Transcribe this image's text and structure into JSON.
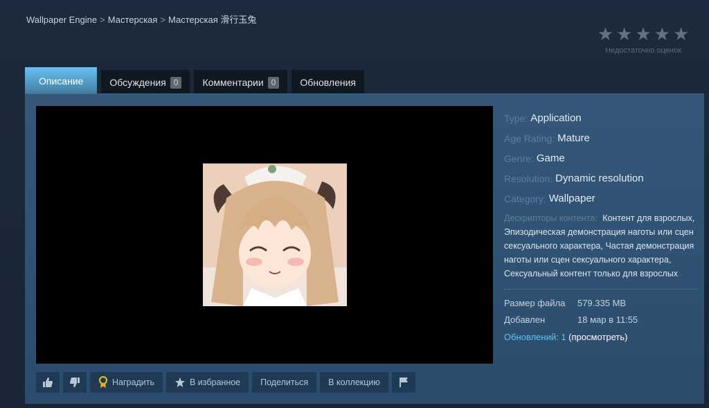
{
  "breadcrumb": {
    "items": [
      "Wallpaper Engine",
      "Мастерская",
      "Мастерская 滑行玉兔"
    ],
    "separator": ">"
  },
  "rating": {
    "stars": [
      "★",
      "★",
      "★",
      "★",
      "★"
    ],
    "text": "Недостаточно оценок"
  },
  "tabs": [
    {
      "label": "Описание",
      "active": true
    },
    {
      "label": "Обсуждения",
      "count": "0"
    },
    {
      "label": "Комментарии",
      "count": "0"
    },
    {
      "label": "Обновления"
    }
  ],
  "meta": {
    "type": {
      "label": "Type:",
      "value": "Application"
    },
    "age": {
      "label": "Age Rating:",
      "value": "Mature"
    },
    "genre": {
      "label": "Genre:",
      "value": "Game"
    },
    "resolution": {
      "label": "Resolution:",
      "value": "Dynamic resolution"
    },
    "category": {
      "label": "Category:",
      "value": "Wallpaper"
    },
    "descriptors": {
      "label": "Дескрипторы контента:",
      "value": "Контент для взрослых, Эпизодическая демонстрация наготы или сцен сексуального характера, Частая демонстрация наготы или сцен сексуального характера, Сексуальный контент только для взрослых"
    }
  },
  "stats": {
    "size": {
      "label": "Размер файла",
      "value": "579.335 MB"
    },
    "added": {
      "label": "Добавлен",
      "value": "18 мар в 11:55"
    }
  },
  "updates": {
    "label": "Обновлений: 1",
    "view": "(просмотреть)"
  },
  "actions": {
    "award": "Наградить",
    "favorite": "В избранное",
    "share": "Поделиться",
    "collection": "В коллекцию"
  },
  "colors": {
    "background": "#1b2838",
    "panel": "#34577a",
    "accent": "#67c1f5",
    "link": "#66c0f4"
  }
}
